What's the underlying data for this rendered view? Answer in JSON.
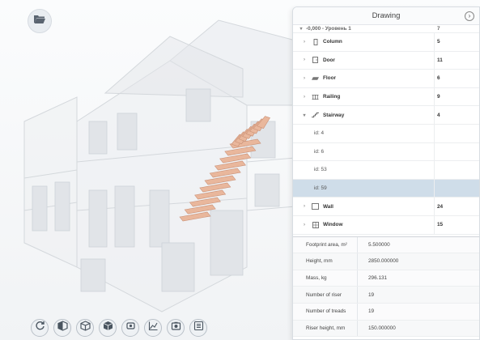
{
  "panel": {
    "title": "Drawing",
    "close_icon": "chevron-right-icon",
    "level": {
      "label": "-0,000 - Уровень 1",
      "count": "7"
    },
    "categories": [
      {
        "label": "Column",
        "count": "5",
        "icon": "column-icon",
        "expanded": false
      },
      {
        "label": "Door",
        "count": "11",
        "icon": "door-icon",
        "expanded": false
      },
      {
        "label": "Floor",
        "count": "6",
        "icon": "floor-icon",
        "expanded": false
      },
      {
        "label": "Railing",
        "count": "9",
        "icon": "railing-icon",
        "expanded": false
      },
      {
        "label": "Stairway",
        "count": "4",
        "icon": "stairway-icon",
        "expanded": true,
        "children": [
          "id: 4",
          "id: 6",
          "id: 53",
          "id: 59"
        ],
        "selected_child": "id: 59"
      },
      {
        "label": "Wall",
        "count": "24",
        "icon": "wall-icon",
        "expanded": false
      },
      {
        "label": "Window",
        "count": "15",
        "icon": "window-icon",
        "expanded": false
      }
    ],
    "properties": [
      {
        "label": "Footprint area, m²",
        "value": "5.500000"
      },
      {
        "label": "Height, mm",
        "value": "2850.000000"
      },
      {
        "label": "Mass, kg",
        "value": "296.131"
      },
      {
        "label": "Number of riser",
        "value": "19"
      },
      {
        "label": "Number of treads",
        "value": "19"
      },
      {
        "label": "Riser height, mm",
        "value": "150.000000"
      }
    ]
  },
  "toolbar": {
    "open_button_icon": "folder-open-icon",
    "tools": [
      "rotate-icon",
      "cube-split-icon",
      "cube-wireframe-icon",
      "cube-solid-icon",
      "eye-icon",
      "chart-icon",
      "camera-icon",
      "list-icon"
    ]
  },
  "colors": {
    "stair": "#e9b79c",
    "selected_row": "#cfdde9",
    "panel_bg": "#ffffff"
  }
}
